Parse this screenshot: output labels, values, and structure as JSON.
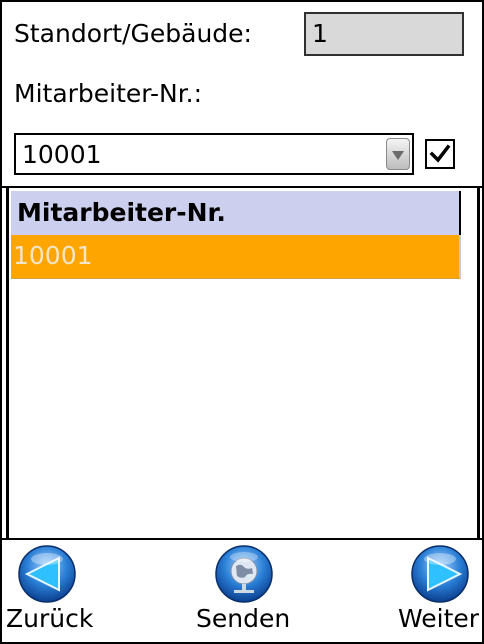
{
  "form": {
    "location_label": "Standort/Gebäude:",
    "location_value": "1",
    "employee_label": "Mitarbeiter-Nr.:",
    "employee_combo_value": "10001",
    "employee_checkbox_checked": true
  },
  "list": {
    "header": "Mitarbeiter-Nr.",
    "rows": [
      "10001"
    ]
  },
  "nav": {
    "back_label": "Zurück",
    "send_label": "Senden",
    "next_label": "Weiter"
  },
  "colors": {
    "list_header_bg": "#cccfed",
    "selected_row_bg": "#ffa500",
    "readonly_field_bg": "#d9d9d9",
    "nav_button_blue": "#2a7fd6"
  },
  "icons": {
    "back": "arrow-left-icon",
    "send": "globe-network-icon",
    "next": "arrow-right-icon",
    "combo": "chevron-down-icon",
    "check": "checkmark-icon"
  }
}
